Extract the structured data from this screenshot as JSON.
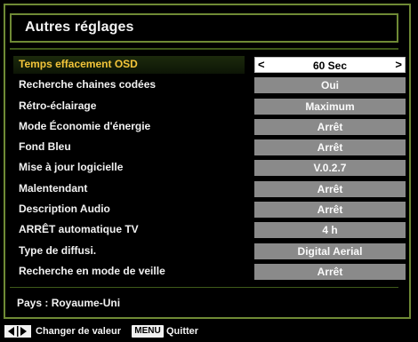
{
  "menu": {
    "title": "Autres réglages"
  },
  "settings": [
    {
      "label": "Temps effacement OSD",
      "value": "60 Sec",
      "selected": true
    },
    {
      "label": "Recherche chaines codées",
      "value": "Oui",
      "selected": false
    },
    {
      "label": "Rétro-éclairage",
      "value": "Maximum",
      "selected": false
    },
    {
      "label": "Mode Économie d'énergie",
      "value": "Arrêt",
      "selected": false
    },
    {
      "label": "Fond Bleu",
      "value": "Arrêt",
      "selected": false
    },
    {
      "label": "Mise à jour logicielle",
      "value": "V.0.2.7",
      "selected": false
    },
    {
      "label": "Malentendant",
      "value": "Arrêt",
      "selected": false
    },
    {
      "label": "Description Audio",
      "value": "Arrêt",
      "selected": false
    },
    {
      "label": "ARRÊT automatique TV",
      "value": "4 h",
      "selected": false
    },
    {
      "label": "Type de diffusi.",
      "value": "Digital Aerial",
      "selected": false
    },
    {
      "label": "Recherche en mode de veille",
      "value": "Arrêt",
      "selected": false
    }
  ],
  "arrows": {
    "left": "<",
    "right": ">"
  },
  "country": {
    "text": "Pays : Royaume-Uni"
  },
  "help": {
    "change_label": "Changer de valeur",
    "menu_key": "MENU",
    "quit_label": "Quitter",
    "arrow_icon": "left-right-arrows-icon"
  },
  "colors": {
    "frame_green": "#6f8a35",
    "selected_label": "#f3c53a",
    "value_box_grey": "#8a8a8a",
    "selected_value_box": "#ffffff"
  }
}
